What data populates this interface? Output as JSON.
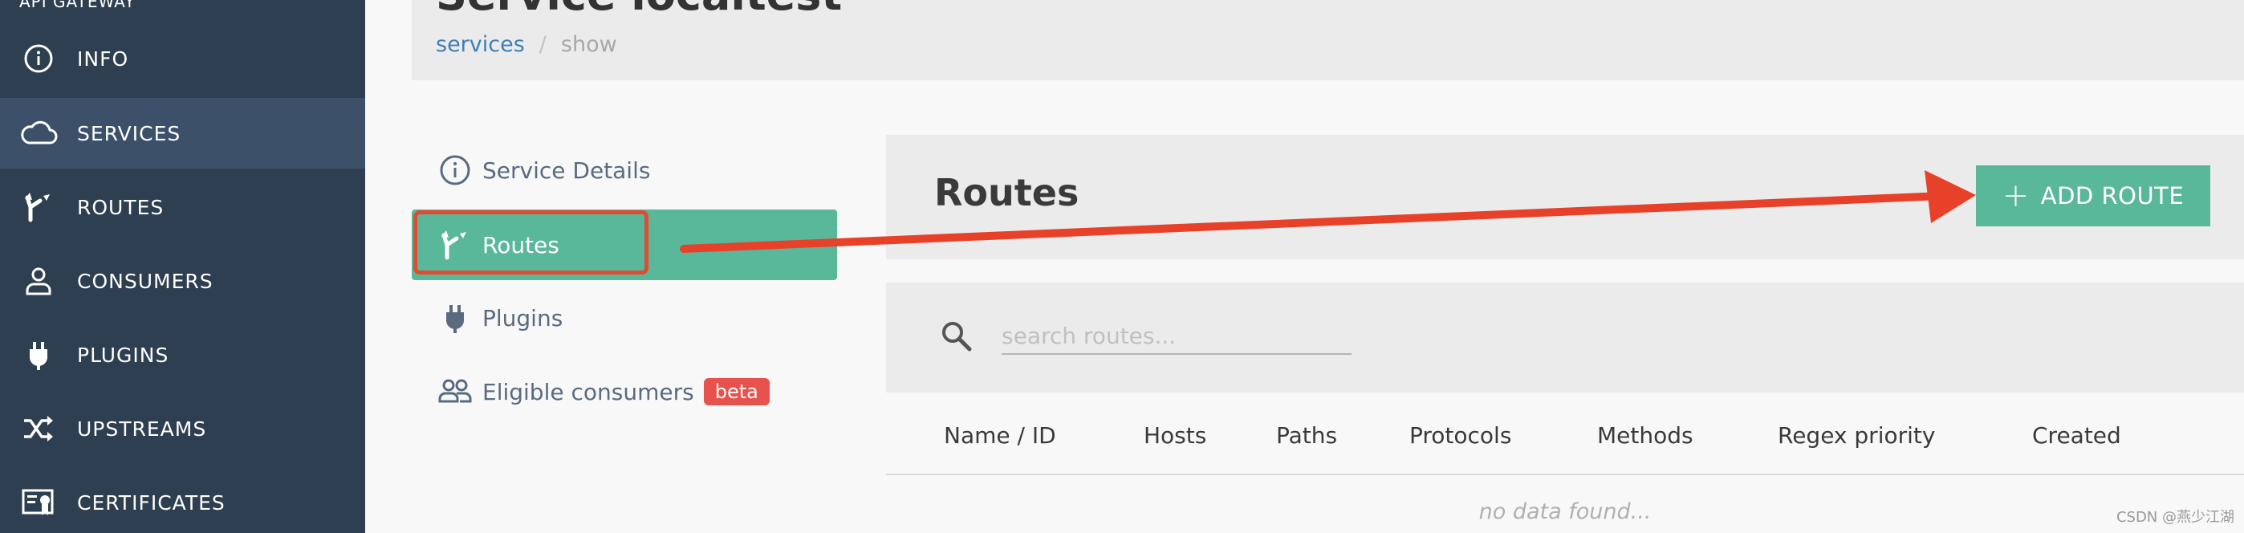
{
  "sidebar": {
    "heading": "API GATEWAY",
    "items": [
      {
        "label": "INFO",
        "icon": "info-icon"
      },
      {
        "label": "SERVICES",
        "icon": "cloud-icon",
        "active": true
      },
      {
        "label": "ROUTES",
        "icon": "routes-icon"
      },
      {
        "label": "CONSUMERS",
        "icon": "user-icon"
      },
      {
        "label": "PLUGINS",
        "icon": "plug-icon"
      },
      {
        "label": "UPSTREAMS",
        "icon": "shuffle-icon"
      },
      {
        "label": "CERTIFICATES",
        "icon": "certificate-icon"
      }
    ]
  },
  "header": {
    "title": "Service localtest",
    "breadcrumb": {
      "link": "services",
      "separator": "/",
      "current": "show"
    }
  },
  "subnav": {
    "items": [
      {
        "label": "Service Details",
        "icon": "info-icon"
      },
      {
        "label": "Routes",
        "icon": "routes-icon",
        "active": true
      },
      {
        "label": "Plugins",
        "icon": "plug-icon"
      },
      {
        "label": "Eligible consumers",
        "icon": "users-icon",
        "badge": "beta"
      }
    ]
  },
  "routes": {
    "title": "Routes",
    "add_button": "ADD ROUTE",
    "search_placeholder": "search routes...",
    "columns": [
      "Name / ID",
      "Hosts",
      "Paths",
      "Protocols",
      "Methods",
      "Regex priority",
      "Created"
    ],
    "empty_text": "no data found..."
  },
  "watermark": "CSDN @燕少江湖",
  "colors": {
    "sidebar_bg": "#2e3f51",
    "accent": "#59b89a",
    "annotation": "#e04b33",
    "badge": "#e8524d"
  }
}
